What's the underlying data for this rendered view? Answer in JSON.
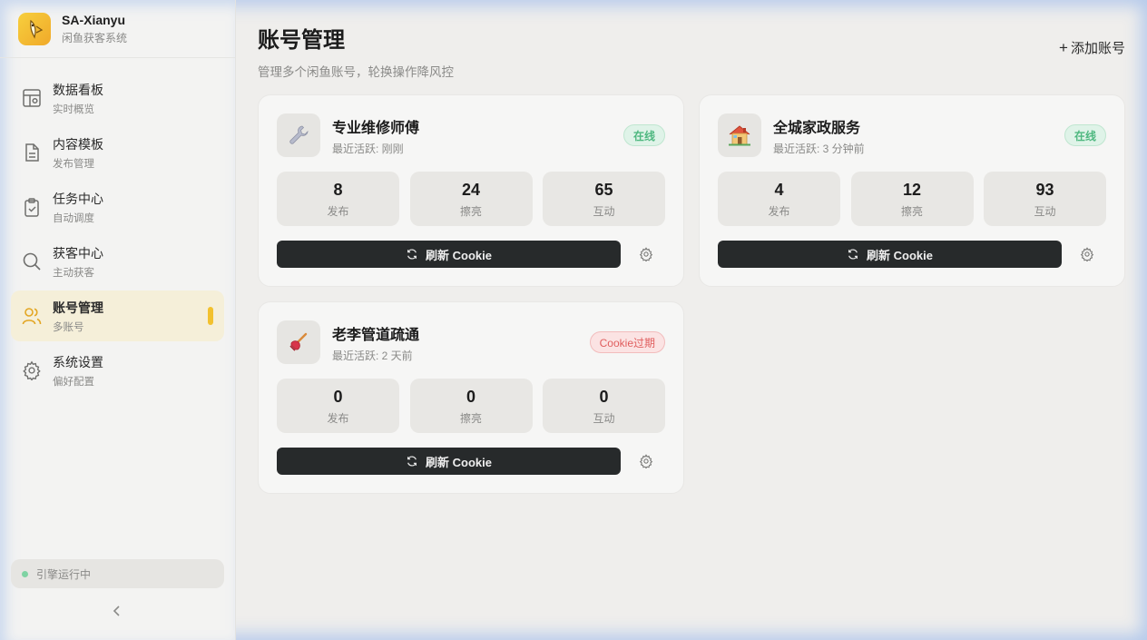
{
  "brand": {
    "name": "SA-Xianyu",
    "subtitle": "闲鱼获客系统"
  },
  "nav": [
    {
      "label": "数据看板",
      "sub": "实时概览",
      "icon": "dashboard-icon",
      "active": false
    },
    {
      "label": "内容模板",
      "sub": "发布管理",
      "icon": "document-icon",
      "active": false
    },
    {
      "label": "任务中心",
      "sub": "自动调度",
      "icon": "clipboard-check-icon",
      "active": false
    },
    {
      "label": "获客中心",
      "sub": "主动获客",
      "icon": "search-icon",
      "active": false
    },
    {
      "label": "账号管理",
      "sub": "多账号",
      "icon": "users-icon",
      "active": true
    },
    {
      "label": "系统设置",
      "sub": "偏好配置",
      "icon": "gear-icon",
      "active": false
    }
  ],
  "engine": {
    "status": "引擎运行中",
    "color": "#7fd3a3"
  },
  "page": {
    "title": "账号管理",
    "subtitle": "管理多个闲鱼账号，轮换操作降风控",
    "add_label": "添加账号",
    "add_symbol": "+"
  },
  "accounts": [
    {
      "name": "专业维修师傅",
      "active": "最近活跃: 刚刚",
      "status": "在线",
      "status_type": "ok",
      "avatar": "🔧",
      "stats": [
        {
          "value": "8",
          "label": "发布"
        },
        {
          "value": "24",
          "label": "擦亮"
        },
        {
          "value": "65",
          "label": "互动"
        }
      ],
      "refresh_label": "刷新 Cookie"
    },
    {
      "name": "全城家政服务",
      "active": "最近活跃: 3 分钟前",
      "status": "在线",
      "status_type": "ok",
      "avatar": "🏠",
      "stats": [
        {
          "value": "4",
          "label": "发布"
        },
        {
          "value": "12",
          "label": "擦亮"
        },
        {
          "value": "93",
          "label": "互动"
        }
      ],
      "refresh_label": "刷新 Cookie"
    },
    {
      "name": "老李管道疏通",
      "active": "最近活跃: 2 天前",
      "status": "Cookie过期",
      "status_type": "bad",
      "avatar": "🪠",
      "stats": [
        {
          "value": "0",
          "label": "发布"
        },
        {
          "value": "0",
          "label": "擦亮"
        },
        {
          "value": "0",
          "label": "互动"
        }
      ],
      "refresh_label": "刷新 Cookie"
    }
  ],
  "colors": {
    "accent": "#f2c12e",
    "dark_button": "#272a2b",
    "online": "#4fb880",
    "expired": "#e05e5e"
  }
}
